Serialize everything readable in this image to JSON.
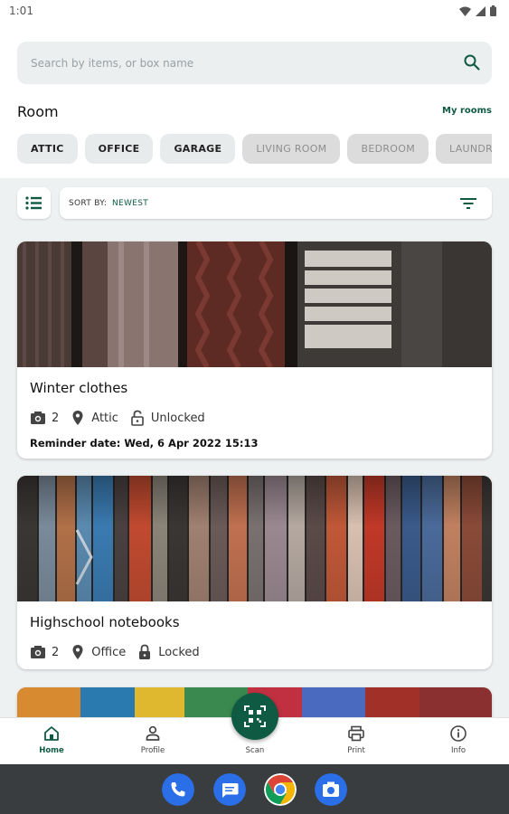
{
  "status_bar": {
    "time": "1:01"
  },
  "search": {
    "placeholder": "Search by items, or box name",
    "icon": "search-icon"
  },
  "rooms": {
    "title": "Room",
    "link": "My rooms",
    "chips": [
      {
        "label": "ATTIC",
        "state": "active"
      },
      {
        "label": "OFFICE",
        "state": "active"
      },
      {
        "label": "GARAGE",
        "state": "active"
      },
      {
        "label": "LIVING ROOM",
        "state": "inactive"
      },
      {
        "label": "BEDROOM",
        "state": "inactive"
      },
      {
        "label": "LAUNDRY ROOM",
        "state": "inactive"
      }
    ]
  },
  "sort": {
    "label": "SORT BY:",
    "value": "NEWEST",
    "view_icon": "list-icon",
    "filter_icon": "filter-icon"
  },
  "boxes": [
    {
      "title": "Winter clothes",
      "photos": "2",
      "room": "Attic",
      "lock_state": "Unlocked",
      "reminder": "Reminder date: Wed, 6 Apr 2022 15:13",
      "image": "winter-clothes-photo"
    },
    {
      "title": "Highschool notebooks",
      "photos": "2",
      "room": "Office",
      "lock_state": "Locked",
      "image": "notebooks-photo"
    }
  ],
  "nav": {
    "home": "Home",
    "profile": "Profile",
    "scan": "Scan",
    "print": "Print",
    "info": "Info"
  },
  "colors": {
    "accent": "#0f5a43",
    "background": "#eef1f2"
  }
}
